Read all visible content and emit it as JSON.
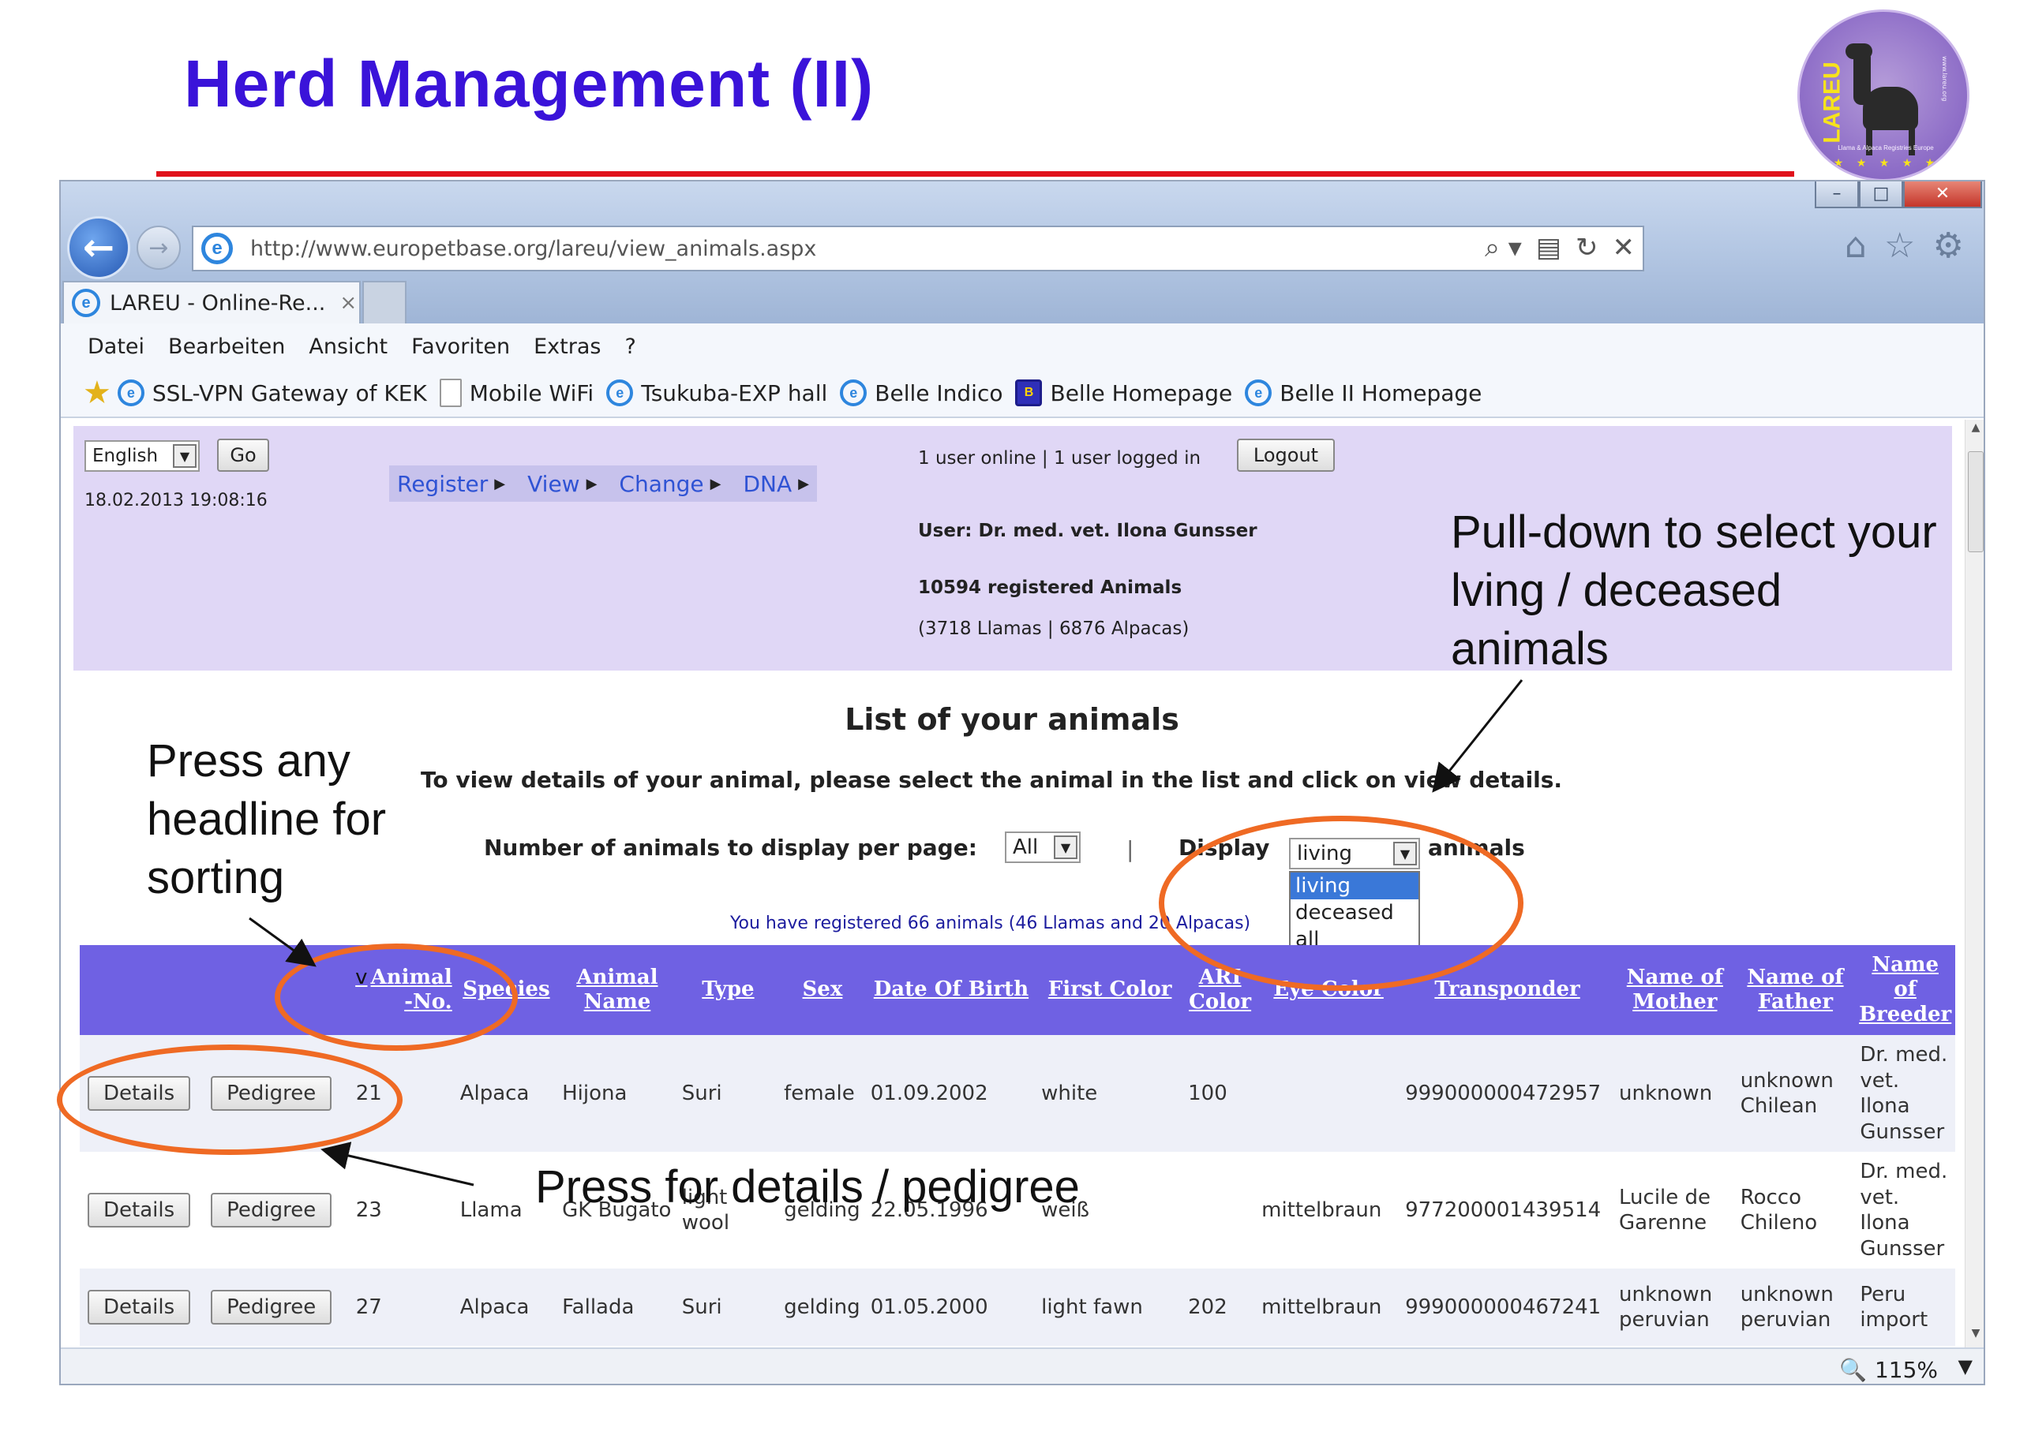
{
  "slide": {
    "title": "Herd Management (II)",
    "logo_text": "LAREU",
    "logo_subtitle": "Llama & Alpaca Registries Europe",
    "logo_url": "www.lareu.org",
    "logo_stars": "★ ★ ★ ★ ★",
    "title_color": "#3a13d9",
    "rule_color": "#e0121b"
  },
  "browser": {
    "url": "http://www.europetbase.org/lareu/view_animals.aspx",
    "tab_title": "LAREU - Online-Re...",
    "tab_close": "×",
    "win_min": "–",
    "win_max": "□",
    "win_close": "✕",
    "back_glyph": "←",
    "forward_glyph": "→",
    "ie_glyph": "e",
    "addr_icons": [
      "⌕ ▾",
      "▤",
      "↻",
      "✕"
    ],
    "toolbar_icons": [
      "⌂",
      "☆",
      "⚙"
    ],
    "menu": [
      "Datei",
      "Bearbeiten",
      "Ansicht",
      "Favoriten",
      "Extras",
      "?"
    ],
    "favorites": [
      {
        "label": "SSL-VPN Gateway of KEK",
        "icon": "ie-icon"
      },
      {
        "label": "Mobile WiFi",
        "icon": "page-icon"
      },
      {
        "label": "Tsukuba-EXP hall",
        "icon": "ie-icon"
      },
      {
        "label": "Belle Indico",
        "icon": "ie-icon"
      },
      {
        "label": "Belle Homepage",
        "icon": "belle-icon"
      },
      {
        "label": "Belle II Homepage",
        "icon": "ie-icon"
      }
    ],
    "fav_star": "★",
    "belle_glyph": "B",
    "zoom": "115%",
    "zoom_icon": "🔍",
    "zoom_caret": "▼",
    "scroll_up": "▲",
    "scroll_down": "▼"
  },
  "page": {
    "language": "English",
    "go_label": "Go",
    "datetime": "18.02.2013 19:08:16",
    "nav": [
      {
        "label": "Register"
      },
      {
        "label": "View"
      },
      {
        "label": "Change"
      },
      {
        "label": "DNA"
      }
    ],
    "nav_triangle": "▶",
    "caret": "▼",
    "online_text": "1 user online | 1 user logged in",
    "logout_label": "Logout",
    "user_text": "User: Dr. med. vet. Ilona Gunsser",
    "registered_text": "10594 registered Animals",
    "registered_breakdown": "(3718 Llamas | 6876 Alpacas)",
    "list_title": "List of your animals",
    "instructions": "To view details of your animal, please select the animal in the list and click on view details.",
    "perpage_label": "Number of animals to display per page:",
    "perpage_value": "All",
    "divider": "|",
    "display_label": "Display",
    "display_value": "living",
    "animals_label": "animals",
    "display_options": [
      "living",
      "deceased",
      "all"
    ],
    "your_registered": "You have registered 66 animals (46 Llamas and 20 Alpacas)",
    "header_color": "#e0d7f6",
    "table_header_color": "#6f61e3"
  },
  "table": {
    "sort_marker": "v",
    "columns": [
      "Animal -No.",
      "Species",
      "Animal Name",
      "Type",
      "Sex",
      "Date Of Birth",
      "First Color",
      "ARI Color",
      "Eye Color",
      "Transponder",
      "Name of Mother",
      "Name of Father",
      "Name of Breeder"
    ],
    "details_label": "Details",
    "pedigree_label": "Pedigree",
    "rows": [
      {
        "no": "21",
        "species": "Alpaca",
        "name": "Hijona",
        "type": "Suri",
        "sex": "female",
        "dob": "01.09.2002",
        "first_color": "white",
        "ari_color": "100",
        "eye_color": "",
        "transponder": "999000000472957",
        "mother": "unknown",
        "father": "unknown Chilean",
        "breeder": "Dr. med. vet. Ilona Gunsser"
      },
      {
        "no": "23",
        "species": "Llama",
        "name": "GK Bugato",
        "type": "light wool",
        "sex": "gelding",
        "dob": "22.05.1996",
        "first_color": "weiß",
        "ari_color": "",
        "eye_color": "mittelbraun",
        "transponder": "977200001439514",
        "mother": "Lucile de Garenne",
        "father": "Rocco Chileno",
        "breeder": "Dr. med. vet. Ilona Gunsser"
      },
      {
        "no": "27",
        "species": "Alpaca",
        "name": "Fallada",
        "type": "Suri",
        "sex": "gelding",
        "dob": "01.05.2000",
        "first_color": "light fawn",
        "ari_color": "202",
        "eye_color": "mittelbraun",
        "transponder": "999000000467241",
        "mother": "unknown peruvian",
        "father": "unknown peruvian",
        "breeder": "Peru import"
      }
    ]
  },
  "annotations": {
    "pulldown": "Pull-down to select your lving / deceased animals",
    "sorting": "Press any headline for sorting",
    "details": "Press for details / pedigree",
    "ellipse_color": "#ef6a24"
  }
}
